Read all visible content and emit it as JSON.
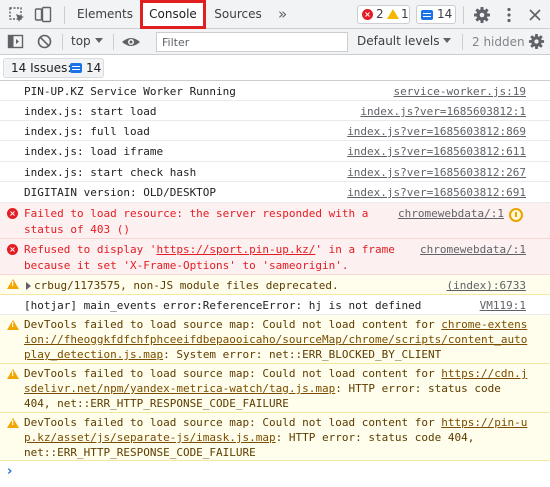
{
  "tabs": [
    {
      "label": "Elements"
    },
    {
      "label": "Console"
    },
    {
      "label": "Sources"
    }
  ],
  "more_tabs_glyph": "»",
  "counts": {
    "errors": "2",
    "warnings": "1",
    "messages": "14"
  },
  "toolbar": {
    "context": "top",
    "filter_placeholder": "Filter",
    "levels": "Default levels",
    "hidden": "2 hidden"
  },
  "issues": {
    "label": "14 Issues:",
    "count": "14"
  },
  "messages": [
    {
      "level": "info",
      "text": "PIN-UP.KZ Service Worker Running",
      "source": "service-worker.js:19"
    },
    {
      "level": "info",
      "text": "index.js: start load",
      "source": "index.js?ver=1685603812:1"
    },
    {
      "level": "info",
      "text": "index.js: full load",
      "source": "index.js?ver=1685603812:869"
    },
    {
      "level": "info",
      "text": "index.js: load iframe",
      "source": "index.js?ver=1685603812:611"
    },
    {
      "level": "info",
      "text": "index.js: start check hash",
      "source": "index.js?ver=1685603812:267"
    },
    {
      "level": "info",
      "text": "DIGITAIN version: OLD/DESKTOP",
      "source": "index.js?ver=1685603812:691"
    },
    {
      "level": "error",
      "line1": "Failed to load resource: the server responded with a",
      "line2": "status of 403 ()",
      "source": "chromewebdata/:1"
    },
    {
      "level": "error",
      "pre": "Refused to display '",
      "link": "https://sport.pin-up.kz/",
      "post": "' in a frame",
      "line2": "because it set 'X-Frame-Options' to 'sameorigin'.",
      "source": "chromewebdata/:1"
    },
    {
      "level": "warning",
      "text": "crbug/1173575, non-JS module files deprecated.",
      "source": "(index):6733"
    },
    {
      "level": "info",
      "text": "[hotjar] main_events error:ReferenceError: hj is not defined",
      "source": "VM119:1"
    },
    {
      "level": "warning",
      "line1": "DevTools failed to load source map: Could not load content for ",
      "link1": "chrome-extens",
      "link2": "ion://fheoggkfdfchfphceeifdbepaooicaho/sourceMap/chrome/scripts/content_auto",
      "link3": "play_detection.js.map",
      "post": ": System error: net::ERR_BLOCKED_BY_CLIENT"
    },
    {
      "level": "warning",
      "line1": "DevTools failed to load source map: Could not load content for ",
      "link1": "https://cdn.j",
      "link2": "sdelivr.net/npm/yandex-metrica-watch/tag.js.map",
      "post": ": HTTP error: status code",
      "line3": "404, net::ERR_HTTP_RESPONSE_CODE_FAILURE"
    },
    {
      "level": "warning",
      "line1": "DevTools failed to load source map: Could not load content for ",
      "link1": "https://pin-u",
      "link2": "p.kz/asset/js/separate-js/imask.js.map",
      "post": ": HTTP error: status code 404,",
      "line3": "net::ERR_HTTP_RESPONSE_CODE_FAILURE"
    }
  ],
  "prompt": "›",
  "colors": {
    "accent": "#1a73e8",
    "error": "#e41c24",
    "warning": "#f2a600",
    "active_tab_border": "#e02020"
  },
  "icons": [
    "inspect-icon",
    "device-toolbar-icon",
    "more-tabs-icon",
    "settings-gear-icon",
    "kebab-menu-icon",
    "sidebar-toggle-icon",
    "clear-console-icon",
    "eye-icon",
    "issues-message-icon",
    "error-icon",
    "warning-icon",
    "expand-triangle-icon",
    "clock-icon",
    "prompt-chevron-icon"
  ]
}
